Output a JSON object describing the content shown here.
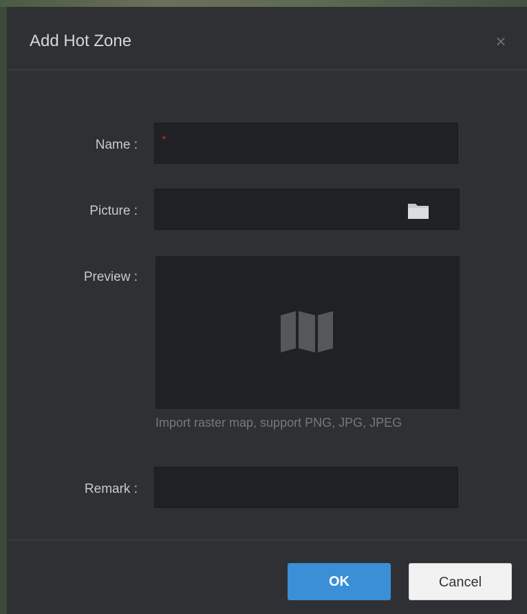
{
  "dialog": {
    "title": "Add Hot Zone",
    "close_glyph": "×"
  },
  "form": {
    "name_label": "Name :",
    "name_value": "",
    "name_required_mark": "*",
    "picture_label": "Picture :",
    "picture_value": "",
    "picture_icon": "folder-icon",
    "preview_label": "Preview :",
    "preview_icon": "map-icon",
    "preview_hint": "Import raster map, support PNG, JPG, JPEG",
    "remark_label": "Remark :",
    "remark_value": ""
  },
  "footer": {
    "ok_label": "OK",
    "cancel_label": "Cancel"
  },
  "colors": {
    "accent": "#3a8fd6",
    "required": "#e02020",
    "dialog_bg": "#2f3033",
    "field_bg": "#202124"
  }
}
